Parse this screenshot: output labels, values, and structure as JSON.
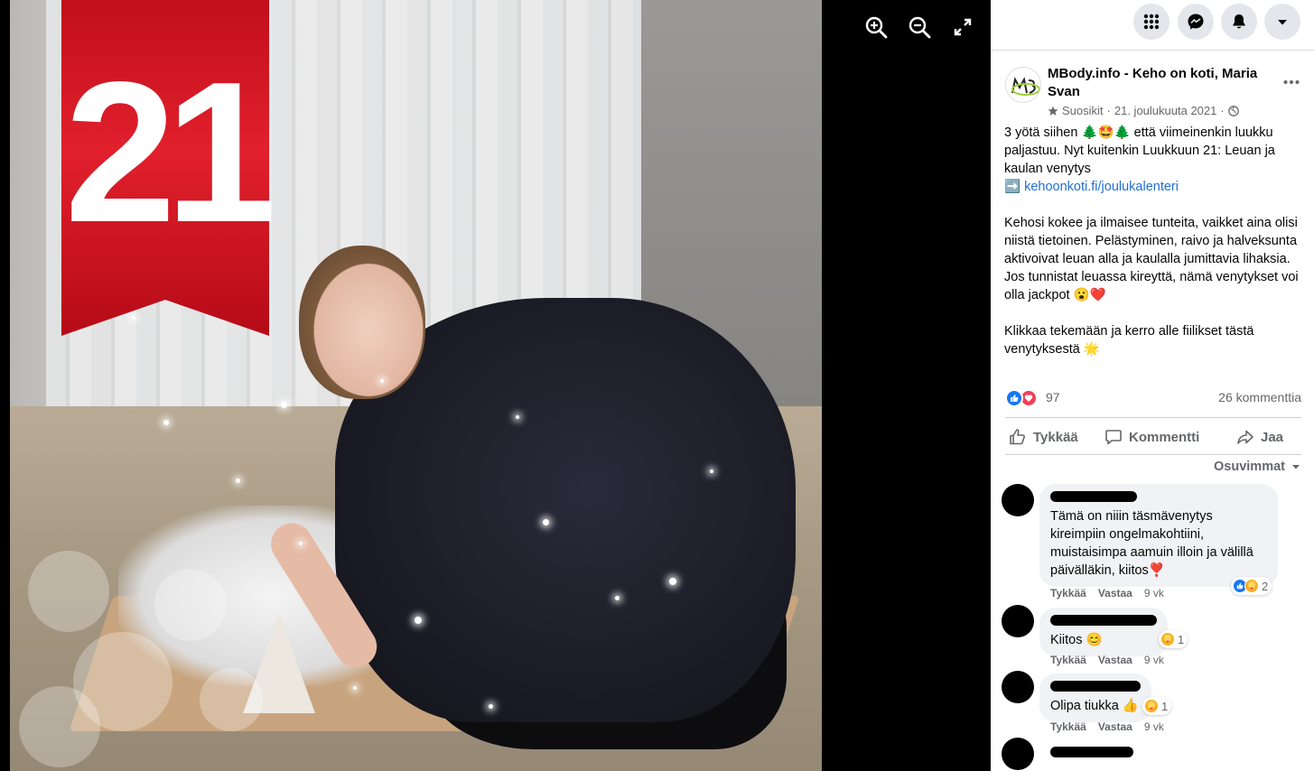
{
  "photo": {
    "ribbon_number": "21",
    "ribbon_color": "#d0131f"
  },
  "viewer_controls": {
    "zoom_in_icon": "zoom-in-icon",
    "zoom_out_icon": "zoom-out-icon",
    "fullscreen_icon": "fullscreen-icon"
  },
  "topbar": {
    "menu_icon": "grid-menu-icon",
    "messenger_icon": "messenger-icon",
    "notifications_icon": "bell-icon",
    "account_icon": "caret-down-icon"
  },
  "post": {
    "page_name": "MBody.info - Keho on koti, Maria Svan",
    "favorites_label": "Suosikit",
    "separator": "·",
    "date": "21. joulukuuta 2021",
    "privacy_icon": "globe-icon",
    "paragraph1_a": "3 yötä siihen ",
    "paragraph1_emoji": "🌲🤩🌲",
    "paragraph1_b": " että viimeinenkin luukku paljastuu. Nyt kuitenkin Luukkuun 21: Leuan ja kaulan venytys",
    "link_arrow": "➡️",
    "link_text": "kehoonkoti.fi/joulukalenteri",
    "paragraph2": "Kehosi kokee ja ilmaisee tunteita, vaikket aina olisi niistä tietoinen. Pelästyminen, raivo ja halveksunta aktivoivat leuan alla ja kaulalla jumittavia lihaksia. Jos tunnistat leuassa kireyttä, nämä venytykset voi olla jackpot ",
    "paragraph2_emoji": "😮❤️",
    "paragraph3": "Klikkaa tekemään ja kerro alle fiilikset tästä venytyksestä ",
    "paragraph3_emoji": "🌟",
    "reaction_count": "97",
    "comment_count": "26 kommenttia"
  },
  "actions": {
    "like": "Tykkää",
    "comment": "Kommentti",
    "share": "Jaa"
  },
  "sort_label": "Osuvimmat",
  "comments": [
    {
      "text": "Tämä on niiin täsmävenytys kireimpiin ongelmakohtiini, muistaisimpa aamuin illoin ja välillä päivälläkin, kiitos❣️",
      "like": "Tykkää",
      "reply": "Vastaa",
      "time": "9 vk",
      "reaction_count": "2"
    },
    {
      "text": "Kiitos 😊",
      "like": "Tykkää",
      "reply": "Vastaa",
      "time": "9 vk",
      "reaction_count": "1"
    },
    {
      "text": "Olipa tiukka 👍",
      "like": "Tykkää",
      "reply": "Vastaa",
      "time": "9 vk",
      "reaction_count": "1"
    }
  ],
  "colors": {
    "link": "#216fdb",
    "like_blue": "#1877f2",
    "love_red": "#f33e58",
    "care_yellow": "#f7b125"
  }
}
